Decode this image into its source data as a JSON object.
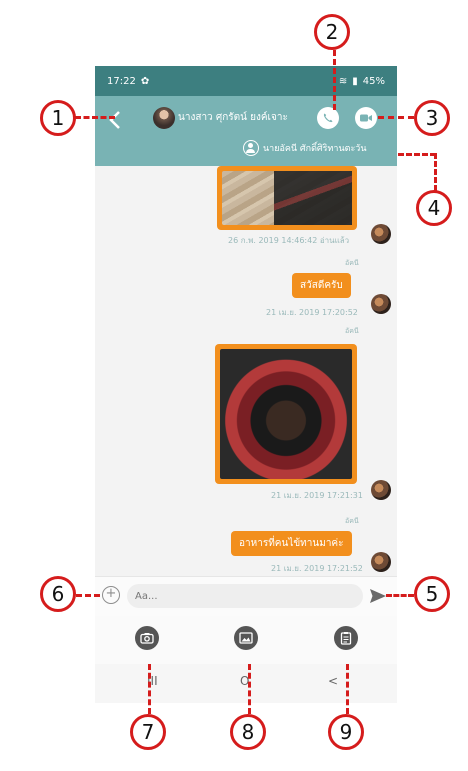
{
  "status_bar": {
    "time": "17:22",
    "battery": "45%"
  },
  "header": {
    "contact_name": "นางสาว ศุกรัตน์ ยงค์เจาะ",
    "member_name": "นายอัคนี ศักดิ์ศิริทานตะวัน"
  },
  "messages": [
    {
      "type": "image",
      "image_desc": "wooden-table-photo",
      "meta": "26 ก.พ. 2019 14:46:42 อ่านแล้ว"
    },
    {
      "type": "text",
      "sender": "อัคนี",
      "text": "สวัสดีครับ",
      "meta": "21 เม.ย. 2019 17:20:52"
    },
    {
      "type": "image",
      "sender": "อัคนี",
      "image_desc": "food-photo",
      "meta": "21 เม.ย. 2019 17:21:31"
    },
    {
      "type": "text",
      "sender": "อัคนี",
      "text": "อาหารที่คนไข้ทานมาค่ะ",
      "meta": "21 เม.ย. 2019 17:21:52"
    }
  ],
  "input": {
    "placeholder": "Aa..."
  },
  "toolbar": {
    "icons": [
      "camera-icon",
      "gallery-icon",
      "clipboard-icon"
    ]
  },
  "nav_bar": {
    "recents": "III",
    "home": "O",
    "back": "<"
  },
  "callouts": [
    "1",
    "2",
    "3",
    "4",
    "5",
    "6",
    "7",
    "8",
    "9"
  ],
  "colors": {
    "header": "#79b3b4",
    "status_bar": "#3d7f80",
    "bubble": "#f28f1d",
    "callout_border": "#d51c1c"
  }
}
